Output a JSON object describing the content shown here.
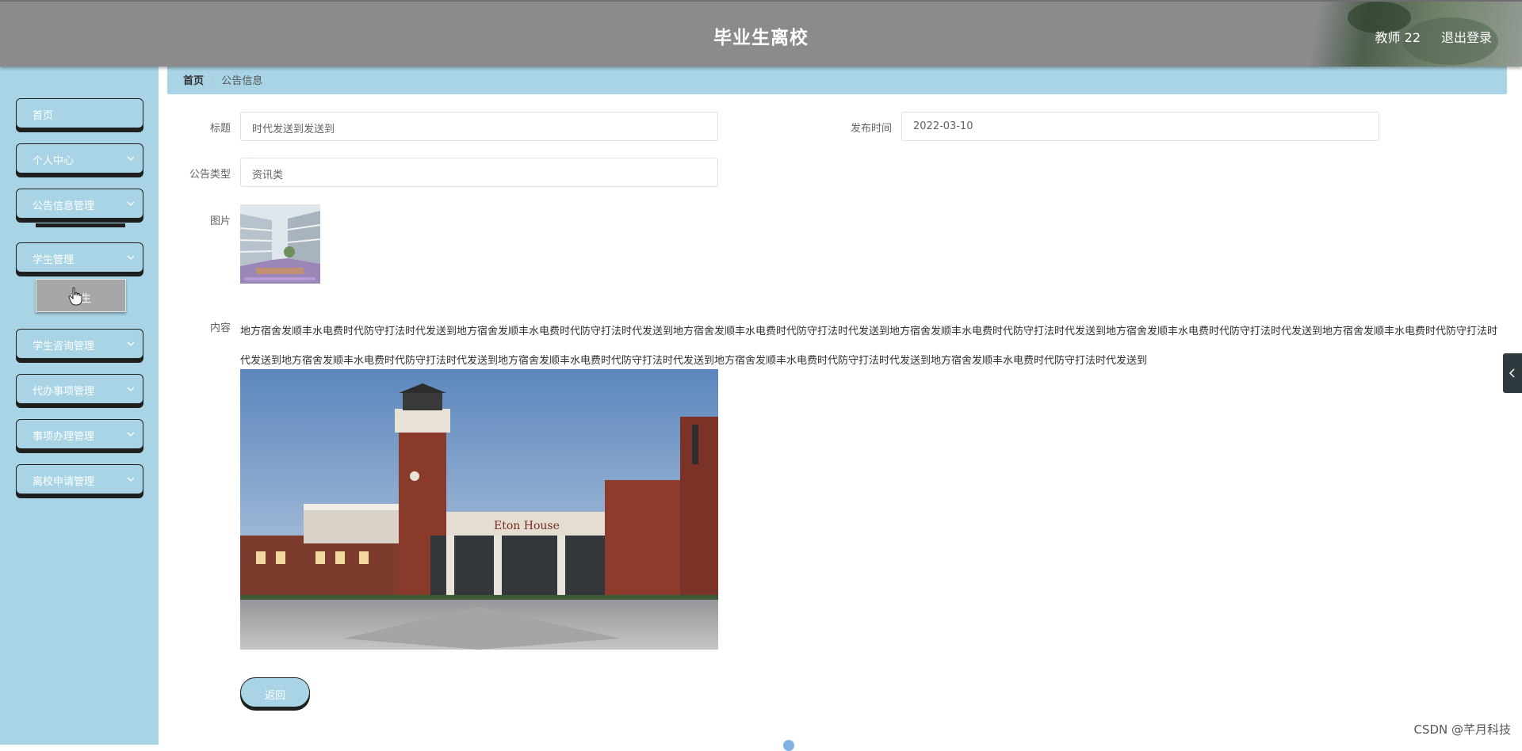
{
  "header": {
    "title": "毕业生离校",
    "user": "教师 22",
    "logout_label": "退出登录"
  },
  "sidebar": {
    "items": [
      {
        "label": "首页"
      },
      {
        "label": "个人中心"
      },
      {
        "label": "公告信息管理"
      },
      {
        "label": "学生管理"
      },
      {
        "label": "学生咨询管理"
      },
      {
        "label": "代办事项管理"
      },
      {
        "label": "事项办理管理"
      },
      {
        "label": "离校申请管理"
      }
    ],
    "sub_item_label": "学生"
  },
  "breadcrumb": {
    "home": "首页",
    "current": "公告信息"
  },
  "form": {
    "title_label": "标题",
    "title_value": "时代发送到发送到",
    "publish_time_label": "发布时间",
    "publish_time_value": "2022-03-10",
    "type_label": "公告类型",
    "type_value": "资讯类",
    "image_label": "图片",
    "content_label": "内容",
    "content_text": "地方宿舍发顺丰水电费时代防守打法时代发送到地方宿舍发顺丰水电费时代防守打法时代发送到地方宿舍发顺丰水电费时代防守打法时代发送到地方宿舍发顺丰水电费时代防守打法时代发送到地方宿舍发顺丰水电费时代防守打法时代发送到地方宿舍发顺丰水电费时代防守打法时代发送到地方宿舍发顺丰水电费时代防守打法时代发送到地方宿舍发顺丰水电费时代防守打法时代发送到地方宿舍发顺丰水电费时代防守打法时代发送到地方宿舍发顺丰水电费时代防守打法时代发送到",
    "photo_sign": "Eton House"
  },
  "actions": {
    "back_label": "返回"
  },
  "watermark": "CSDN @芊月科技",
  "colors": {
    "header_bg": "#8b8b8d",
    "sidebar_bg": "#a9d4e5",
    "accent": "#a9d4e5"
  }
}
